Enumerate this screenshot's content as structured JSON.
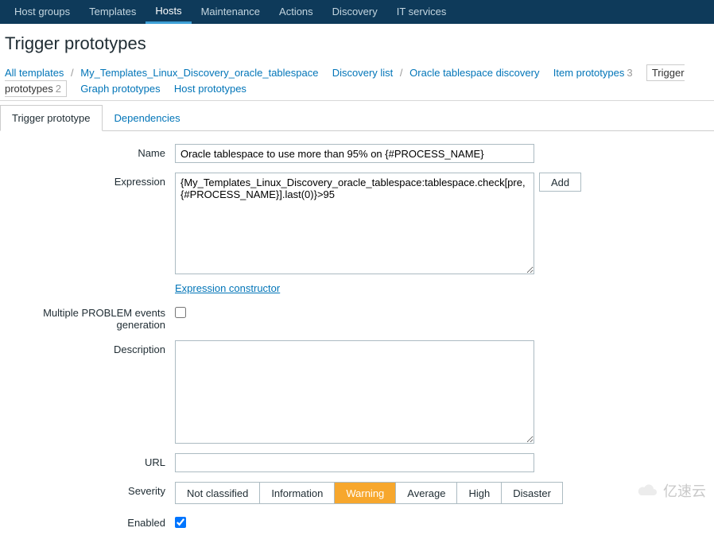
{
  "topnav": {
    "items": [
      {
        "label": "Host groups"
      },
      {
        "label": "Templates"
      },
      {
        "label": "Hosts",
        "active": true
      },
      {
        "label": "Maintenance"
      },
      {
        "label": "Actions"
      },
      {
        "label": "Discovery"
      },
      {
        "label": "IT services"
      }
    ]
  },
  "page_title": "Trigger prototypes",
  "breadcrumb": {
    "all_templates": "All templates",
    "template_name": "My_Templates_Linux_Discovery_oracle_tablespace",
    "discovery_list": "Discovery list",
    "discovery_rule": "Oracle tablespace discovery",
    "item_prototypes": "Item prototypes",
    "item_prototypes_count": "3",
    "trigger_prototypes": "Trigger prototypes",
    "trigger_prototypes_count": "2",
    "graph_prototypes": "Graph prototypes",
    "host_prototypes": "Host prototypes"
  },
  "tabs": {
    "trigger_prototype": "Trigger prototype",
    "dependencies": "Dependencies"
  },
  "form": {
    "name_label": "Name",
    "name_value": "Oracle tablespace to use more than 95% on {#PROCESS_NAME}",
    "expression_label": "Expression",
    "expression_value": "{My_Templates_Linux_Discovery_oracle_tablespace:tablespace.check[pre,{#PROCESS_NAME}].last(0)}>95",
    "add_button": "Add",
    "expression_constructor": "Expression constructor",
    "multiple_label": "Multiple PROBLEM events generation",
    "multiple_checked": false,
    "description_label": "Description",
    "description_value": "",
    "url_label": "URL",
    "url_value": "",
    "severity_label": "Severity",
    "severity_options": [
      "Not classified",
      "Information",
      "Warning",
      "Average",
      "High",
      "Disaster"
    ],
    "severity_selected": "Warning",
    "enabled_label": "Enabled",
    "enabled_checked": true
  },
  "watermark": "亿速云"
}
